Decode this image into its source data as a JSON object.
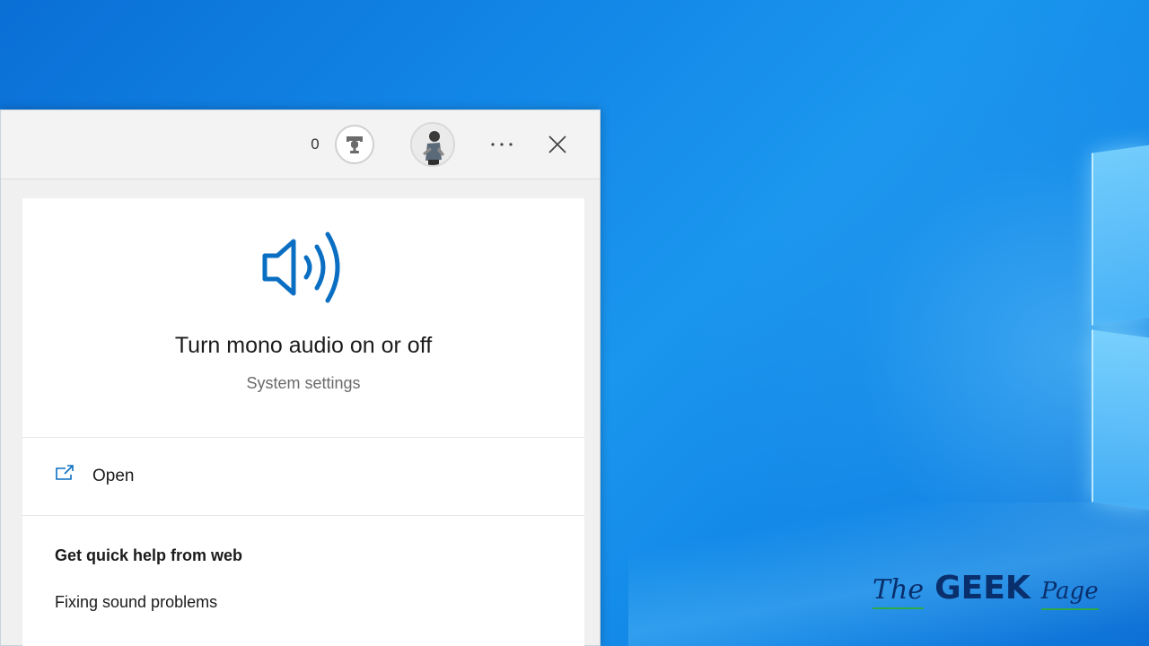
{
  "header": {
    "points_count": "0"
  },
  "setting_card": {
    "title": "Turn mono audio on or off",
    "subtitle": "System settings"
  },
  "actions": {
    "open_label": "Open"
  },
  "web_help": {
    "heading": "Get quick help from web",
    "links": [
      "Fixing sound problems"
    ]
  },
  "watermark": {
    "the": "The",
    "geek": "GEEK",
    "page": "Page"
  },
  "colors": {
    "accent": "#0a6fc2",
    "desktop": "#1285e6"
  },
  "icons": {
    "rewards": "trophy-icon",
    "more": "more-options-icon",
    "close": "close-icon",
    "hero": "speaker-volume-icon",
    "open": "open-external-icon"
  }
}
